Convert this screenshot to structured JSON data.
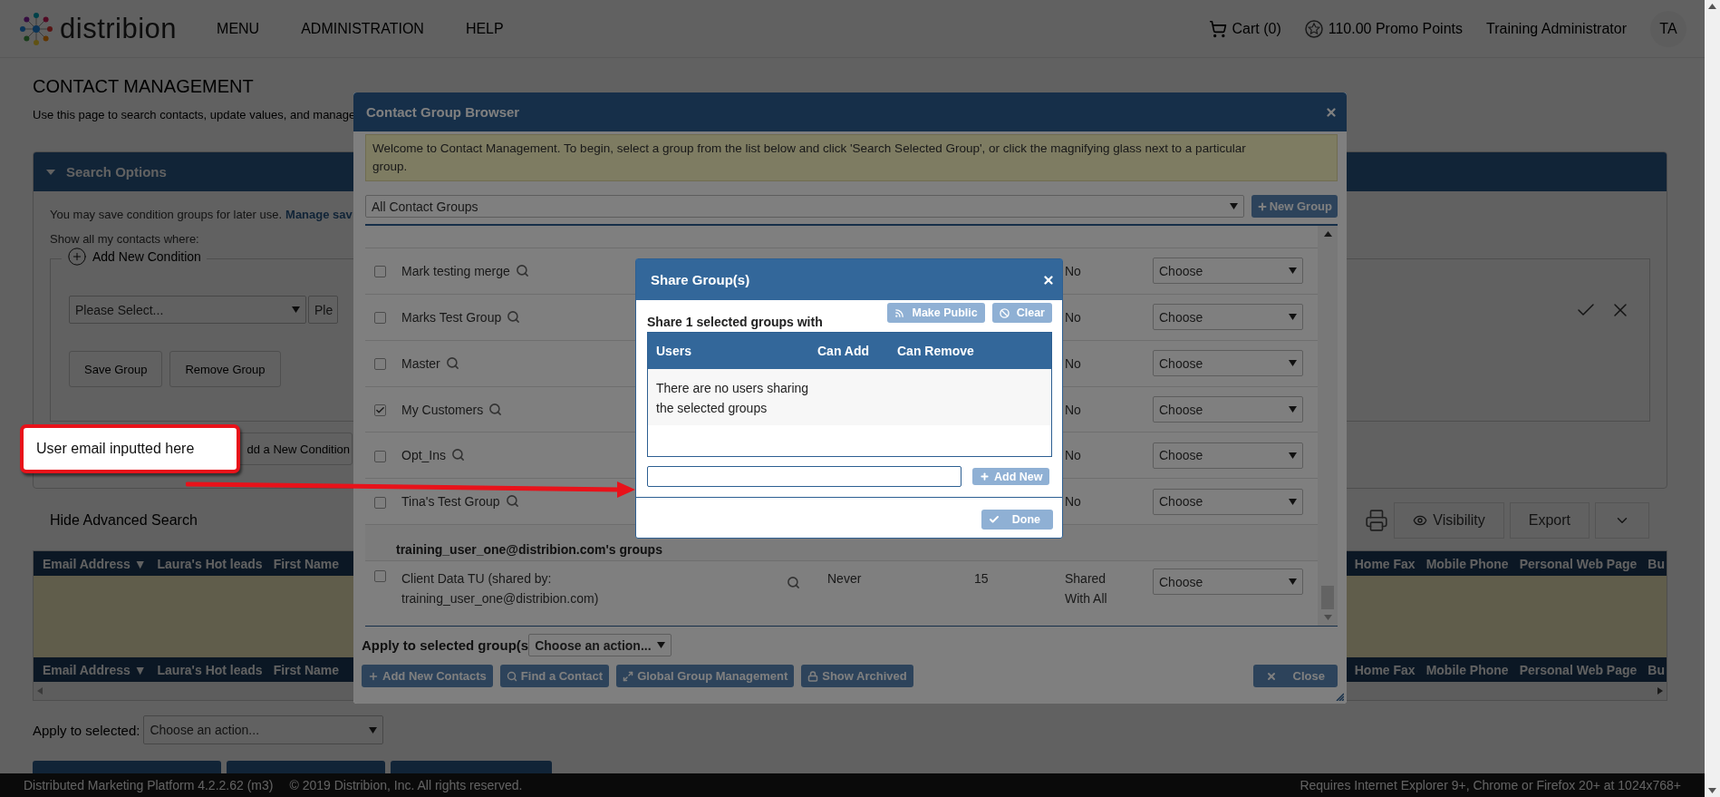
{
  "header": {
    "logo": "distribion",
    "nav": [
      "MENU",
      "ADMINISTRATION",
      "HELP"
    ],
    "cart": "Cart (0)",
    "promo_points": "110.00 Promo Points",
    "user": "Training Administrator",
    "avatar": "TA"
  },
  "page": {
    "title": "CONTACT MANAGEMENT",
    "subtitle": "Use this page to search contacts, update values, and manage"
  },
  "search_options": {
    "title": "Search Options",
    "expanded": true,
    "intro": "You may save condition groups for later use.",
    "intro_link": "Manage sav",
    "show_label": "Show all my contacts where:",
    "add_condition": "Add New Condition",
    "field_select": "Please Select...",
    "operator_select": "Ple",
    "buttons": [
      "Save Group",
      "Remove Group"
    ],
    "add_group_button": "dd a New Condition"
  },
  "advanced_toggle": "Hide Advanced Search",
  "toolbar": {
    "visibility": "Visibility",
    "export": "Export"
  },
  "results_table": {
    "header_left": [
      "Email Address ▼",
      "Laura's Hot leads",
      "First Name"
    ],
    "header_right": [
      "Home Fax",
      "Mobile Phone",
      "Personal Web Page",
      "Bu"
    ],
    "footer_left": [
      "Email Address ▼",
      "Laura's Hot leads",
      "First Name"
    ],
    "footer_right": [
      "Home Fax",
      "Mobile Phone",
      "Personal Web Page",
      "Bu"
    ]
  },
  "apply": {
    "label": "Apply to selected:",
    "select": "Choose an action..."
  },
  "footer": {
    "left": "Distributed Marketing Platform 4.2.2.62 (m3)",
    "copyright": "© 2019 Distribion, Inc. All rights reserved.",
    "right": "Requires Internet Explorer 9+, Chrome or Firefox 20+ at 1024x768+"
  },
  "group_browser": {
    "title": "Contact Group Browser",
    "info": "Welcome to Contact Management. To begin, select a group from the list below and click 'Search Selected Group', or click the magnifying glass next to a particular group.",
    "group_filter": "All Contact Groups",
    "new_group": "New Group",
    "rows": [
      {
        "name": "Mark testing merge",
        "checked": false,
        "shared": "No",
        "action": "Choose"
      },
      {
        "name": "Marks Test Group",
        "checked": false,
        "shared": "No",
        "action": "Choose"
      },
      {
        "name": "Master",
        "checked": false,
        "shared": "No",
        "action": "Choose"
      },
      {
        "name": "My Customers",
        "checked": true,
        "shared": "No",
        "action": "Choose"
      },
      {
        "name": "Opt_Ins",
        "checked": false,
        "shared": "No",
        "action": "Choose"
      },
      {
        "name": "Tina's Test Group",
        "checked": false,
        "shared": "No",
        "action": "Choose"
      }
    ],
    "section": "training_user_one@distribion.com's groups",
    "shared_rows": [
      {
        "name": "Client Data TU (shared by: training_user_one@distribion.com)",
        "checked": false,
        "last_used": "Never",
        "count": "15",
        "shared": "Shared With All",
        "action": "Choose"
      }
    ],
    "apply_label": "Apply to selected group(s",
    "apply_select": "Choose an action...",
    "buttons": [
      {
        "kind": "add",
        "label": "Add New Contacts"
      },
      {
        "kind": "find",
        "label": "Find a Contact"
      },
      {
        "kind": "global",
        "label": "Global Group Management"
      },
      {
        "kind": "archived",
        "label": "Show Archived"
      }
    ],
    "close": "Close"
  },
  "share_dialog": {
    "title": "Share Group(s)",
    "prompt": "Share 1 selected groups with",
    "make_public": "Make Public",
    "clear": "Clear",
    "columns": [
      "Users",
      "Can Add",
      "Can Remove"
    ],
    "empty_message": "There are no users sharing the selected groups",
    "add_new": "Add New",
    "done": "Done"
  },
  "annotation": {
    "text": "User email inputted here"
  }
}
